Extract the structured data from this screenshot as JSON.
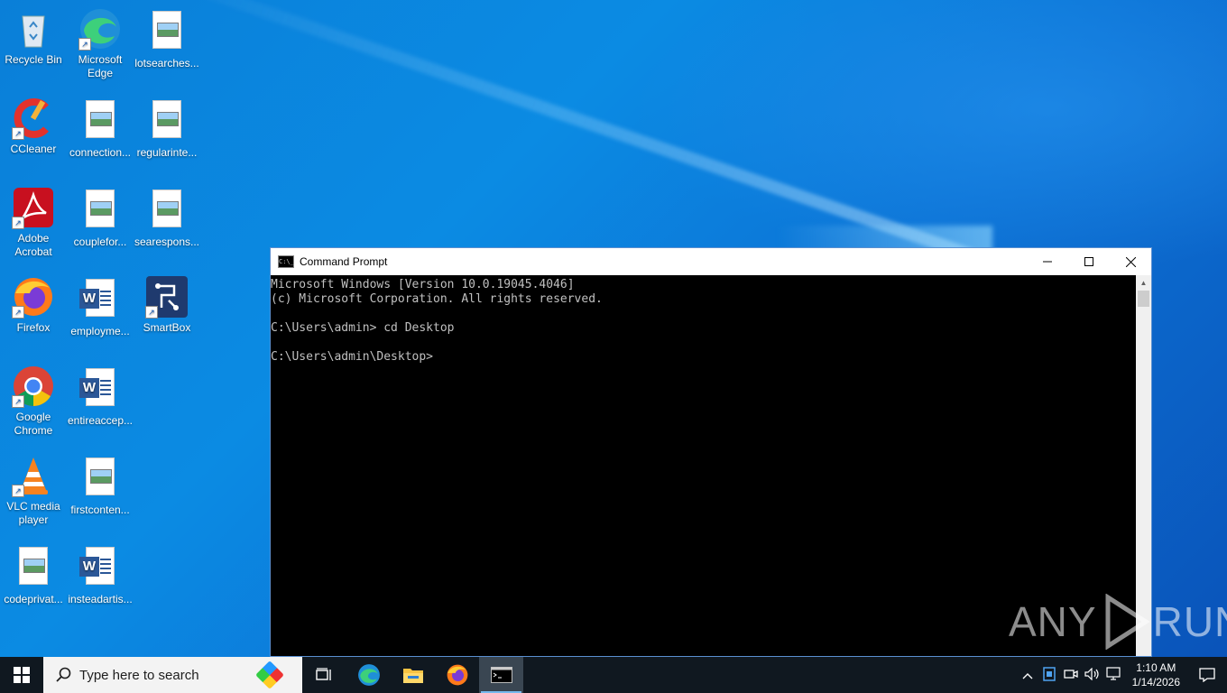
{
  "desktop": {
    "icons": [
      {
        "label": "Recycle Bin",
        "type": "recycle"
      },
      {
        "label": "Microsoft Edge",
        "type": "edge"
      },
      {
        "label": "lotsearches...",
        "type": "image-file"
      },
      {
        "label": "CCleaner",
        "type": "ccleaner"
      },
      {
        "label": "connection...",
        "type": "image-file"
      },
      {
        "label": "regularinte...",
        "type": "image-file"
      },
      {
        "label": "Adobe Acrobat",
        "type": "acrobat"
      },
      {
        "label": "couplefor...",
        "type": "image-file"
      },
      {
        "label": "searespons...",
        "type": "image-file"
      },
      {
        "label": "Firefox",
        "type": "firefox"
      },
      {
        "label": "employme...",
        "type": "word-file"
      },
      {
        "label": "SmartBox",
        "type": "smartbox"
      },
      {
        "label": "Google Chrome",
        "type": "chrome"
      },
      {
        "label": "entireaccep...",
        "type": "word-file"
      },
      {
        "label": "VLC media player",
        "type": "vlc"
      },
      {
        "label": "firstconten...",
        "type": "image-file"
      },
      {
        "label": "codeprivat...",
        "type": "image-file"
      },
      {
        "label": "insteadartis...",
        "type": "word-file"
      }
    ]
  },
  "cmd_window": {
    "title": "Command Prompt",
    "icon_text": "C:\\_",
    "lines": [
      "Microsoft Windows [Version 10.0.19045.4046]",
      "(c) Microsoft Corporation. All rights reserved.",
      "",
      "C:\\Users\\admin> cd Desktop",
      "",
      "C:\\Users\\admin\\Desktop>"
    ]
  },
  "watermark": {
    "left": "ANY",
    "right": "RUN"
  },
  "taskbar": {
    "search_placeholder": "Type here to search",
    "apps": [
      "task-view-icon",
      "edge-icon",
      "file-explorer-icon",
      "firefox-icon",
      "cmd-icon"
    ],
    "clock_time": "1:10 AM",
    "clock_date": "1/14/2026"
  },
  "colors": {
    "desktop_accent": "#0a7fd8",
    "taskbar": "#101820",
    "console_text": "#c0c0c0"
  }
}
